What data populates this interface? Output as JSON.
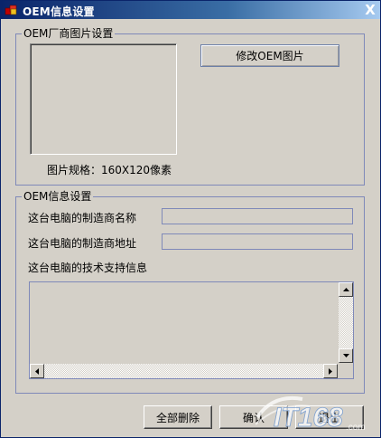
{
  "window": {
    "title": "OEM信息设置",
    "close_label": "X"
  },
  "logo_group": {
    "title": "OEM厂商图片设置",
    "modify_button": "修改OEM图片",
    "image_spec": "图片规格：160X120像素"
  },
  "info_group": {
    "title": "OEM信息设置",
    "manufacturer_name_label": "这台电脑的制造商名称",
    "manufacturer_name_value": "",
    "manufacturer_address_label": "这台电脑的制造商地址",
    "manufacturer_address_value": "",
    "support_info_label": "这台电脑的技术支持信息",
    "support_info_value": ""
  },
  "footer": {
    "delete_all_button": "全部删除",
    "ok_button": "确认",
    "exit_button": "退出"
  },
  "watermark": {
    "text": "IT168",
    "suffix": ".com"
  },
  "colors": {
    "title_bar_start": "#0a246a",
    "title_bar_end": "#a6caf0",
    "dialog_face": "#d4d0c8",
    "group_border": "#7f89b9"
  },
  "icons": {
    "app": "oem-cubes-icon",
    "close": "close-icon",
    "scroll_up": "triangle-up-icon",
    "scroll_down": "triangle-down-icon",
    "scroll_left": "triangle-left-icon",
    "scroll_right": "triangle-right-icon"
  }
}
